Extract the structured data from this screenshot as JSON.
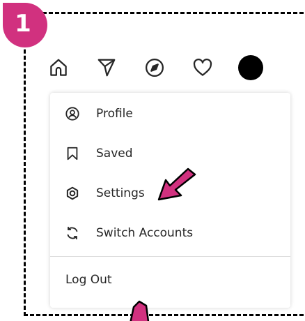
{
  "step": {
    "number": "1"
  },
  "navbar": {
    "icons": [
      "home-icon",
      "direct-send-icon",
      "explore-compass-icon",
      "activity-heart-icon",
      "profile-avatar"
    ]
  },
  "menu": {
    "items": [
      {
        "label": "Profile",
        "icon": "profile-icon"
      },
      {
        "label": "Saved",
        "icon": "bookmark-icon"
      },
      {
        "label": "Settings",
        "icon": "settings-gear-icon"
      },
      {
        "label": "Switch Accounts",
        "icon": "switch-accounts-icon"
      }
    ],
    "logout_label": "Log Out"
  },
  "colors": {
    "accent": "#d1317f",
    "frame": "#000000",
    "text": "#262626",
    "divider": "#dbdbdb"
  }
}
